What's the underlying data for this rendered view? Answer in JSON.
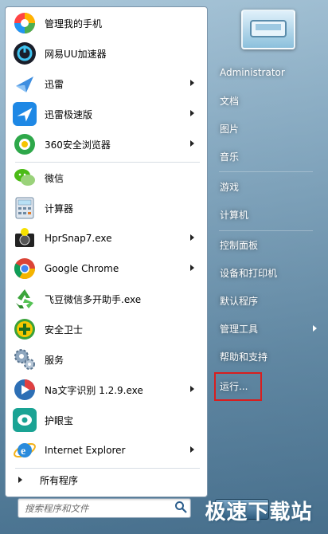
{
  "left_menu": {
    "items": [
      {
        "label": "管理我的手机",
        "icon": "phone-manager-icon",
        "arrow": false
      },
      {
        "label": "网易UU加速器",
        "icon": "uu-accelerator-icon",
        "arrow": false
      },
      {
        "label": "迅雷",
        "icon": "xunlei-icon",
        "arrow": true
      },
      {
        "label": "迅雷极速版",
        "icon": "xunlei-speed-icon",
        "arrow": true
      },
      {
        "label": "360安全浏览器",
        "icon": "360-browser-icon",
        "arrow": true
      },
      {
        "label": "微信",
        "icon": "wechat-icon",
        "arrow": false
      },
      {
        "label": "计算器",
        "icon": "calculator-icon",
        "arrow": false
      },
      {
        "label": "HprSnap7.exe",
        "icon": "hypersnap-icon",
        "arrow": true
      },
      {
        "label": "Google Chrome",
        "icon": "chrome-icon",
        "arrow": true
      },
      {
        "label": "飞豆微信多开助手.exe",
        "icon": "recycle-icon",
        "arrow": false
      },
      {
        "label": "安全卫士",
        "icon": "security-guard-icon",
        "arrow": false
      },
      {
        "label": "服务",
        "icon": "services-gear-icon",
        "arrow": false
      },
      {
        "label": "Na文字识别 1.2.9.exe",
        "icon": "ocr-icon",
        "arrow": true
      },
      {
        "label": "护眼宝",
        "icon": "eye-care-icon",
        "arrow": false
      },
      {
        "label": "Internet Explorer",
        "icon": "ie-icon",
        "arrow": true
      }
    ],
    "all_programs": "所有程序"
  },
  "search": {
    "placeholder": "搜索程序和文件"
  },
  "right_menu": {
    "items": [
      {
        "label": "Administrator",
        "arrow": false
      },
      {
        "label": "文档",
        "arrow": false
      },
      {
        "label": "图片",
        "arrow": false
      },
      {
        "label": "音乐",
        "arrow": false
      },
      {
        "label": "游戏",
        "arrow": false
      },
      {
        "label": "计算机",
        "arrow": false
      },
      {
        "label": "控制面板",
        "arrow": false
      },
      {
        "label": "设备和打印机",
        "arrow": false
      },
      {
        "label": "默认程序",
        "arrow": false
      },
      {
        "label": "管理工具",
        "arrow": true
      },
      {
        "label": "帮助和支持",
        "arrow": false
      },
      {
        "label": "运行...",
        "arrow": false
      }
    ]
  },
  "watermark": "极速下载站",
  "colors": {
    "highlight_box": "#d81e1e",
    "panel_bg": "#ffffff",
    "right_text": "#ffffff"
  }
}
